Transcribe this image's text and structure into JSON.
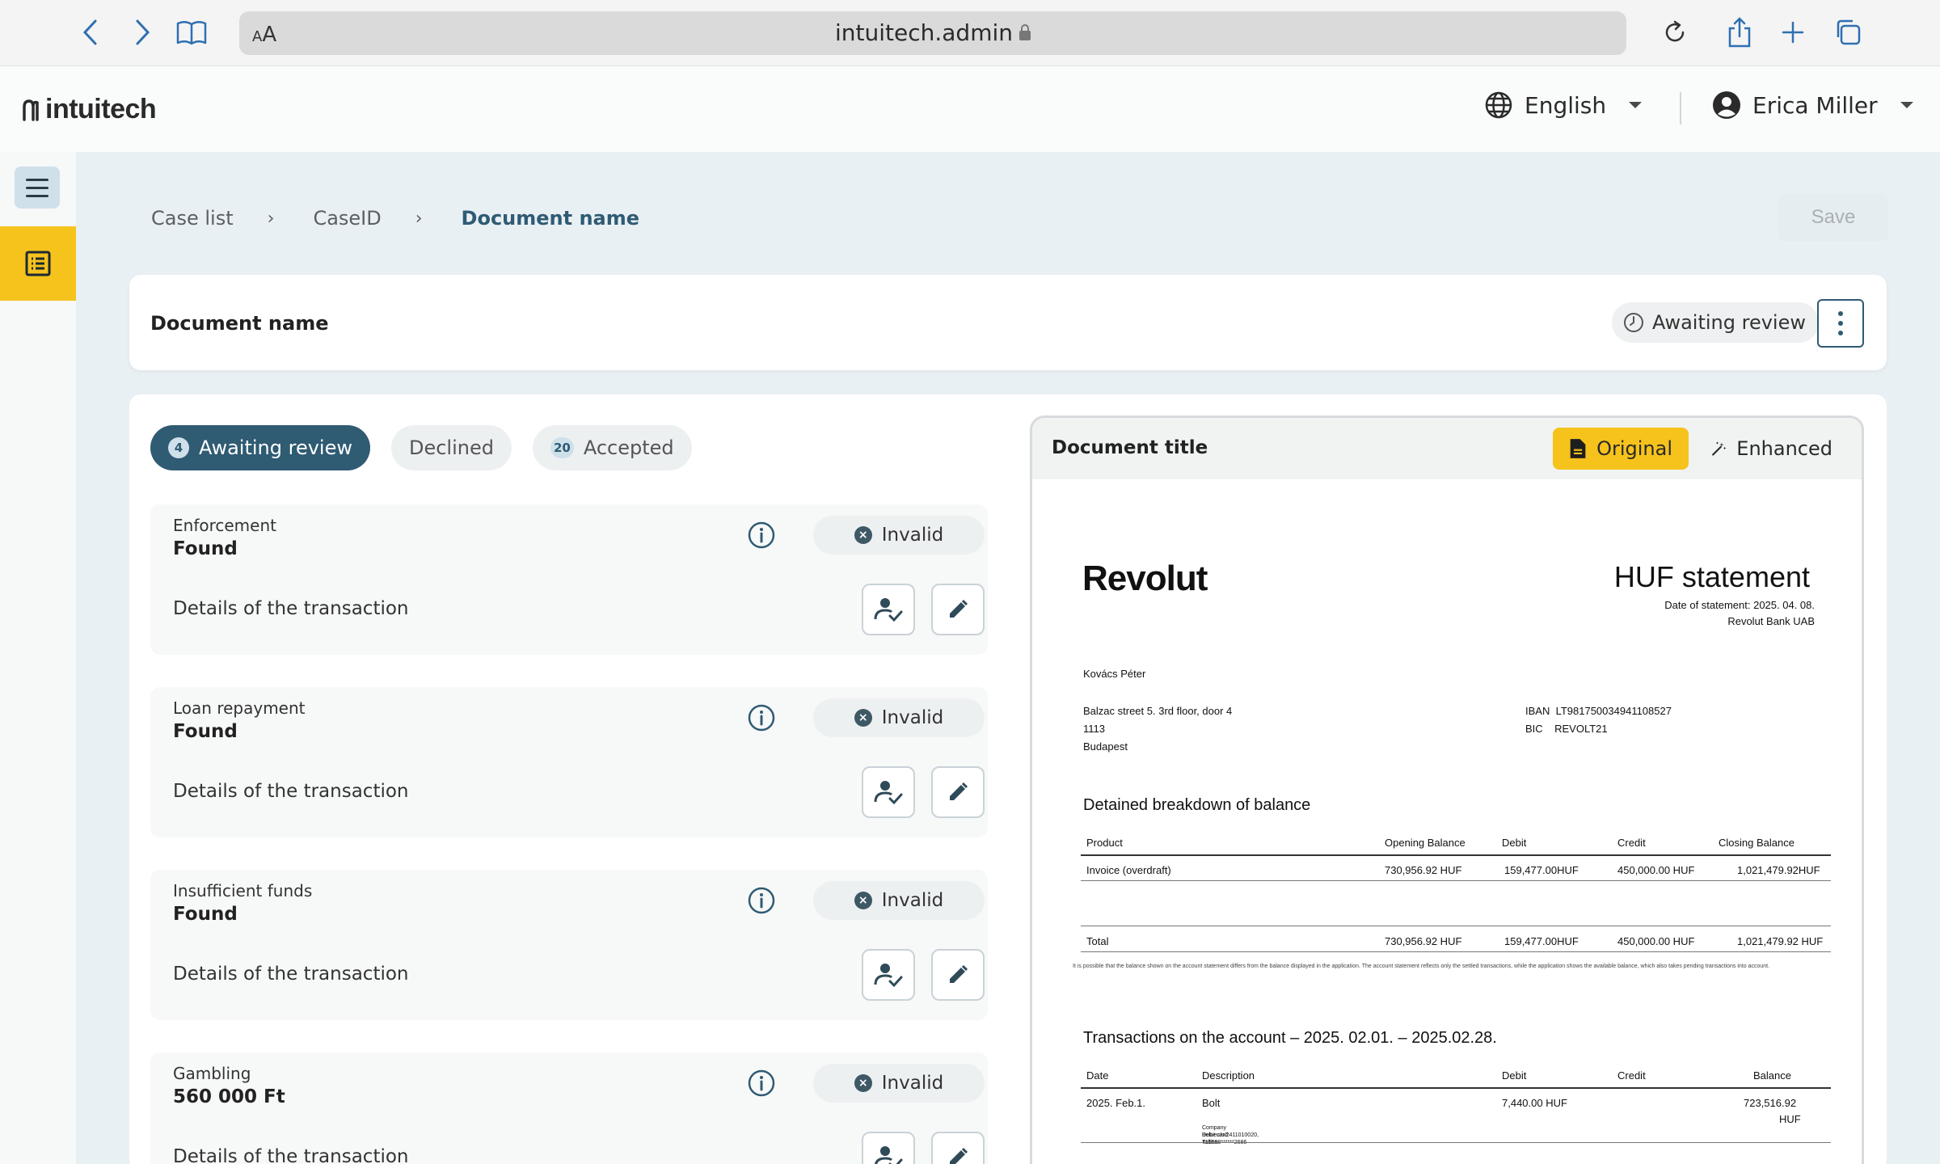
{
  "browser": {
    "url": "intuitech.admin",
    "aa_label": "AA"
  },
  "header": {
    "logo": "intuitech",
    "language": "English",
    "user_name": "Erica Miller"
  },
  "breadcrumb": {
    "items": [
      "Case list",
      "CaseID",
      "Document name"
    ],
    "separator": "›"
  },
  "toolbar": {
    "save_label": "Save"
  },
  "document_card": {
    "title": "Document name",
    "status": "Awaiting review"
  },
  "tabs": [
    {
      "label": "Awaiting review",
      "count": "4",
      "active": true
    },
    {
      "label": "Declined",
      "count": "",
      "active": false
    },
    {
      "label": "Accepted",
      "count": "20",
      "active": false
    }
  ],
  "findings": [
    {
      "category": "Enforcement",
      "value": "Found",
      "details": "Details of the transaction",
      "status": "Invalid"
    },
    {
      "category": "Loan repayment",
      "value": "Found",
      "details": "Details of the transaction",
      "status": "Invalid"
    },
    {
      "category": "Insufficient funds",
      "value": "Found",
      "details": "Details of the transaction",
      "status": "Invalid"
    },
    {
      "category": "Gambling",
      "value": "560 000 Ft",
      "details": "Details of the transaction",
      "status": "Invalid"
    }
  ],
  "viewer": {
    "title": "Document title",
    "original_label": "Original",
    "enhanced_label": "Enhanced"
  },
  "statement": {
    "bank_logo": "Revolut",
    "title": "HUF statement",
    "date_line": "Date of statement: 2025. 04. 08.",
    "bank_name": "Revolut Bank UAB",
    "customer": "Kovács Péter",
    "address1": "Balzac street 5. 3rd floor, door 4",
    "address2": "1113",
    "address3": "Budapest",
    "iban_label": "IBAN",
    "iban": "LT981750034941108527",
    "bic_label": "BIC",
    "bic": "REVOLT21",
    "breakdown_heading": "Detained breakdown of balance",
    "breakdown_headers": [
      "Product",
      "Opening Balance",
      "Debit",
      "Credit",
      "Closing Balance"
    ],
    "breakdown_row": [
      "Invoice (overdraft)",
      "730,956.92 HUF",
      "159,477.00HUF",
      "450,000.00 HUF",
      "1,021,479.92HUF"
    ],
    "total_row": [
      "Total",
      "730,956.92 HUF",
      "159,477.00HUF",
      "450,000.00 HUF",
      "1,021,479.92 HUF"
    ],
    "fine_print": "It is possible that the balance shown on the account statement differs from the balance displayed in the application. The account statement reflects only the settled transactions, while the application shows the available balance, which also takes pending transactions into account.",
    "transactions_heading": "Transactions on the account – 2025. 02.01. – 2025.02.28.",
    "tx_headers": [
      "Date",
      "Description",
      "Debit",
      "Credit",
      "Balance"
    ],
    "tx_row": [
      "2025. Feb.1.",
      "Bolt",
      "7,440.00 HUF",
      "",
      "723,516.92"
    ],
    "tx_balance_unit": "HUF",
    "tx_sub1": "Company Bolt.eu/o/2411010020, Tallinn",
    "tx_sub2": "Debit card: 416598******2686"
  }
}
